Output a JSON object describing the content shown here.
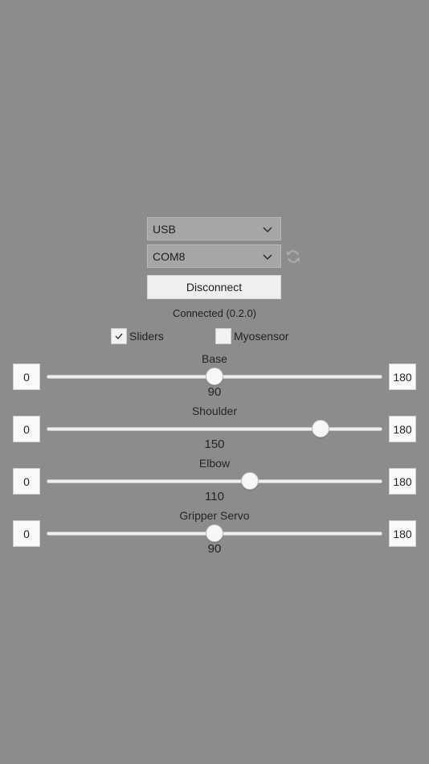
{
  "connection": {
    "type_selected": "USB",
    "port_selected": "COM8",
    "refresh_icon": "refresh-icon",
    "disconnect_label": "Disconnect",
    "status": "Connected (0.2.0)"
  },
  "toggles": {
    "sliders": {
      "label": "Sliders",
      "checked": true
    },
    "myosensor": {
      "label": "Myosensor",
      "checked": false
    }
  },
  "sliders": [
    {
      "label": "Base",
      "min": "0",
      "max": "180",
      "value": "90"
    },
    {
      "label": "Shoulder",
      "min": "0",
      "max": "180",
      "value": "150"
    },
    {
      "label": "Elbow",
      "min": "0",
      "max": "180",
      "value": "110"
    },
    {
      "label": "Gripper Servo",
      "min": "0",
      "max": "180",
      "value": "90"
    }
  ]
}
